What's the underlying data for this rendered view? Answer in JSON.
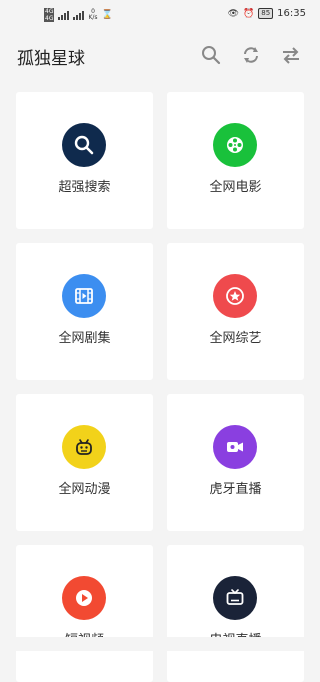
{
  "status_bar": {
    "sim1": "4G",
    "sim2": "4G",
    "speed": "0",
    "speed_unit": "K/s",
    "battery": "85",
    "time": "16:35"
  },
  "header": {
    "title": "孤独星球"
  },
  "grid": {
    "items": [
      {
        "label": "超强搜索",
        "icon": "search-icon",
        "color": "#0f2a4d"
      },
      {
        "label": "全网电影",
        "icon": "film-reel-icon",
        "color": "#19c13b"
      },
      {
        "label": "全网剧集",
        "icon": "film-strip-icon",
        "color": "#3c8ef0"
      },
      {
        "label": "全网综艺",
        "icon": "star-icon",
        "color": "#ef4a4d"
      },
      {
        "label": "全网动漫",
        "icon": "robot-face-icon",
        "color": "#f2d21a"
      },
      {
        "label": "虎牙直播",
        "icon": "video-camera-icon",
        "color": "#8a3fe0"
      },
      {
        "label": "短视频",
        "icon": "play-icon",
        "color": "#f24a32"
      },
      {
        "label": "电视直播",
        "icon": "tv-icon",
        "color": "#1a2338"
      }
    ]
  }
}
